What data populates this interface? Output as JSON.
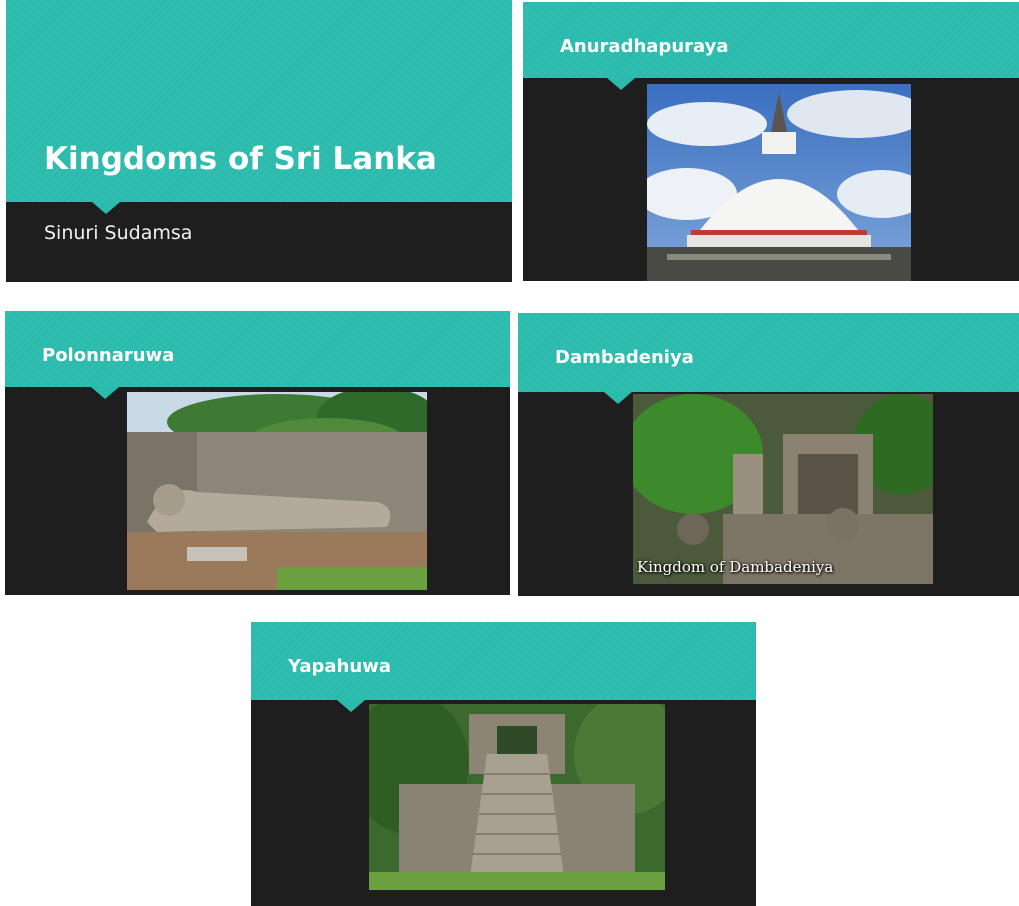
{
  "title_slide": {
    "title": "Kingdoms of Sri Lanka",
    "subtitle": "Sinuri Sudamsa"
  },
  "slides": [
    {
      "title": "Anuradhapuraya",
      "image_icon": "stupa-photo"
    },
    {
      "title": "Polonnaruwa",
      "image_icon": "reclining-buddha-photo"
    },
    {
      "title": "Dambadeniya",
      "image_icon": "temple-ruins-photo",
      "caption": "Kingdom of Dambadeniya"
    },
    {
      "title": "Yapahuwa",
      "image_icon": "stone-staircase-photo"
    }
  ],
  "colors": {
    "accent": "#2bbbad",
    "slide_background": "#1e1e1e",
    "title_text": "#ffffff"
  }
}
